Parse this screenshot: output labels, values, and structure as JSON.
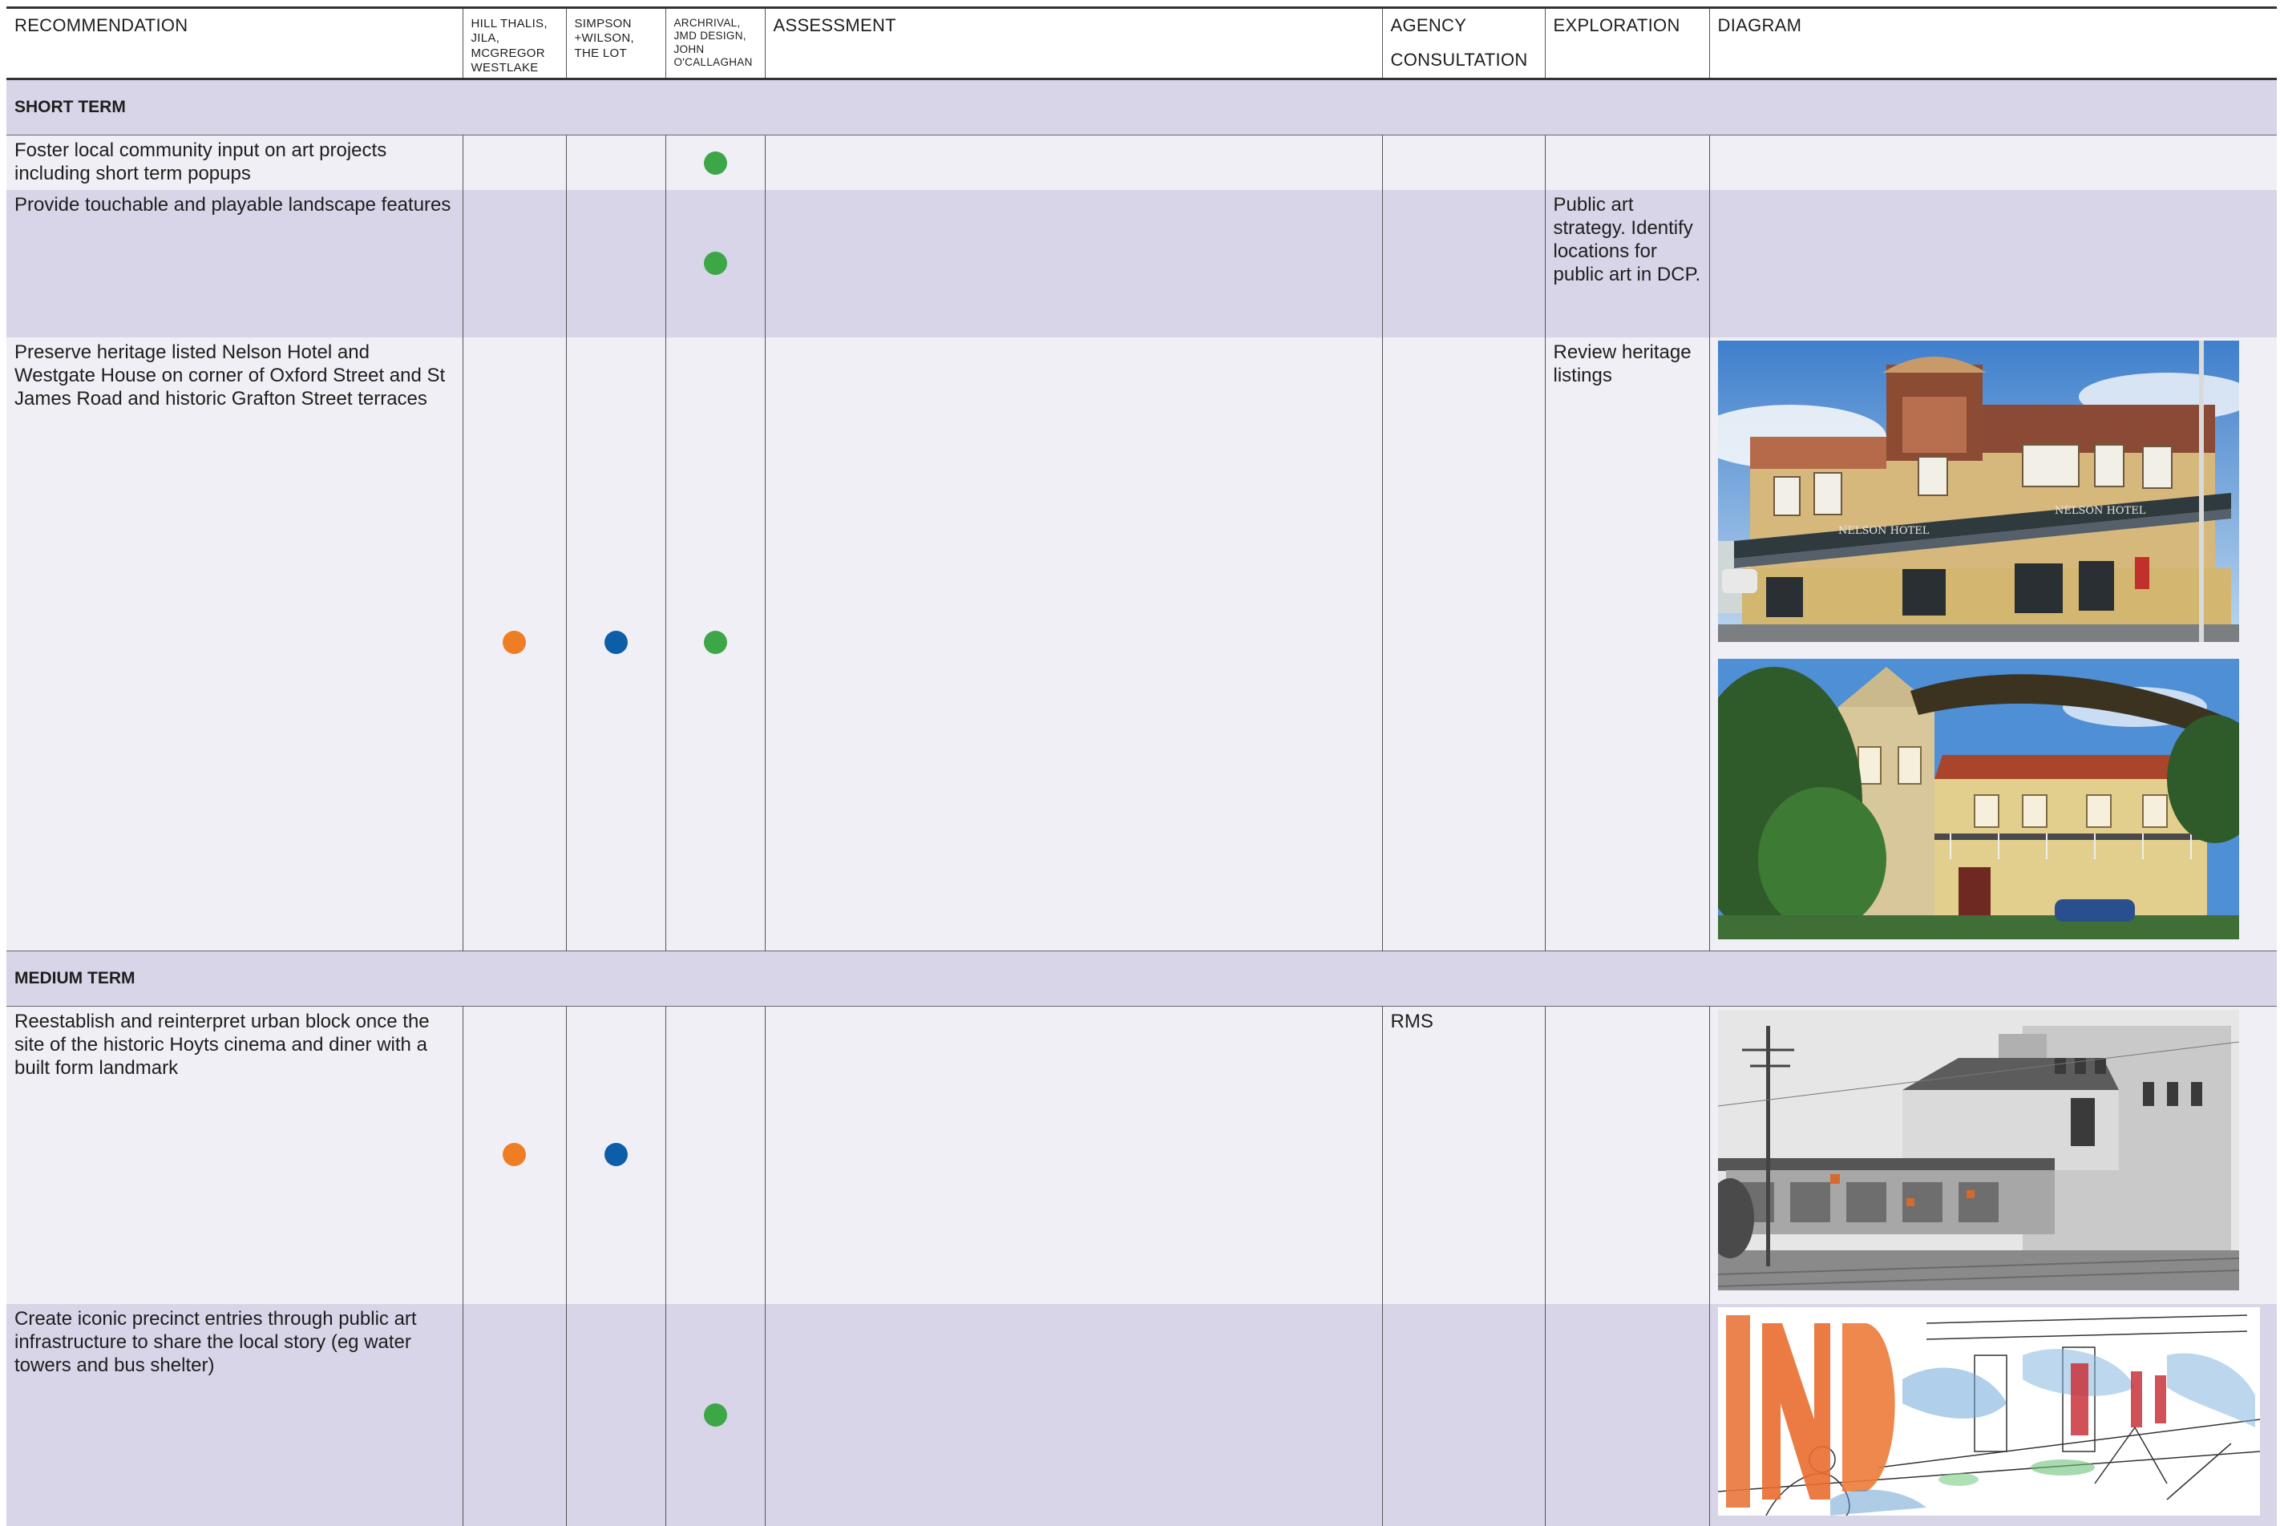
{
  "headers": {
    "recommendation": "RECOMMENDATION",
    "col_hill": "HILL THALIS, JILA, MCGREGOR WESTLAKE",
    "col_simpson": "SIMPSON +WILSON, THE LOT",
    "col_archrival": "ARCHRIVAL, JMD DESIGN, JOHN O'CALLAGHAN",
    "assessment": "ASSESSMENT",
    "agency_line1": "AGENCY",
    "agency_line2": "CONSULTATION",
    "exploration": "EXPLORATION",
    "diagram": "DIAGRAM"
  },
  "sections": [
    {
      "label": "SHORT TERM",
      "rows": [
        {
          "recommendation": "Foster local community input on art projects including short term popups",
          "hill": false,
          "simpson": false,
          "archrival": true,
          "assessment": "",
          "agency": "",
          "exploration": "",
          "diagram": []
        },
        {
          "recommendation": "Provide touchable and playable landscape features",
          "hill": false,
          "simpson": false,
          "archrival": true,
          "assessment": "",
          "agency": "",
          "exploration": "Public art strategy. Identify locations for public art in DCP.",
          "diagram": []
        },
        {
          "recommendation": "Preserve heritage listed Nelson Hotel and Westgate House on corner of Oxford Street and St James Road and historic Grafton Street terraces",
          "hill": true,
          "simpson": true,
          "archrival": true,
          "assessment": "",
          "agency": "",
          "exploration": "Review heritage listings",
          "diagram": [
            "nelson-hotel-photo",
            "westgate-house-photo"
          ],
          "signage": [
            "NELSON HOTEL",
            "NELSON HOTEL"
          ]
        }
      ]
    },
    {
      "label": "MEDIUM TERM",
      "rows": [
        {
          "recommendation": "Reestablish and reinterpret urban block once the site of the historic Hoyts cinema and diner with a built form landmark",
          "hill": true,
          "simpson": true,
          "archrival": false,
          "assessment": "",
          "agency": "RMS",
          "exploration": "",
          "diagram": [
            "hoyts-cinema-photo"
          ]
        },
        {
          "recommendation": "Create iconic precinct entries through public art infrastructure to share the local story (eg water towers and bus shelter)",
          "hill": false,
          "simpson": false,
          "archrival": true,
          "assessment": "",
          "agency": "",
          "exploration": "",
          "diagram": [
            "precinct-entry-sketch"
          ]
        }
      ]
    }
  ],
  "colors": {
    "hill": "#ef7d24",
    "simpson": "#0d5ea8",
    "archrival": "#3da748",
    "band": "#d8d5e8",
    "light": "#f0eff5"
  }
}
